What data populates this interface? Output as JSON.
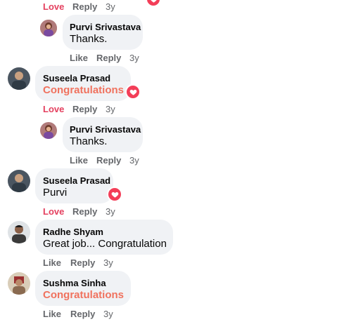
{
  "comments": [
    {
      "actions": {
        "like": "Love",
        "reply": "Reply",
        "time": "3y"
      }
    },
    {
      "author": "Purvi Srivastava",
      "text": "Thanks.",
      "actions": {
        "like": "Like",
        "reply": "Reply",
        "time": "3y"
      }
    },
    {
      "author": "Suseela Prasad",
      "text": "Congratulations",
      "actions": {
        "like": "Love",
        "reply": "Reply",
        "time": "3y"
      }
    },
    {
      "author": "Purvi Srivastava",
      "text": "Thanks.",
      "actions": {
        "like": "Like",
        "reply": "Reply",
        "time": "3y"
      }
    },
    {
      "author": "Suseela Prasad",
      "text": "Purvi",
      "actions": {
        "like": "Love",
        "reply": "Reply",
        "time": "3y"
      }
    },
    {
      "author": "Radhe Shyam",
      "text": "Great job... Congratulation",
      "actions": {
        "like": "Like",
        "reply": "Reply",
        "time": "3y"
      }
    },
    {
      "author": "Sushma Sinha",
      "text": "Congratulations",
      "actions": {
        "like": "Like",
        "reply": "Reply",
        "time": "3y"
      }
    }
  ],
  "colors": {
    "love": "#e4405f",
    "congrats_text": "#f0725e",
    "heart_badge": "#f33e58",
    "bubble": "#f0f2f5",
    "meta": "#65676b"
  }
}
